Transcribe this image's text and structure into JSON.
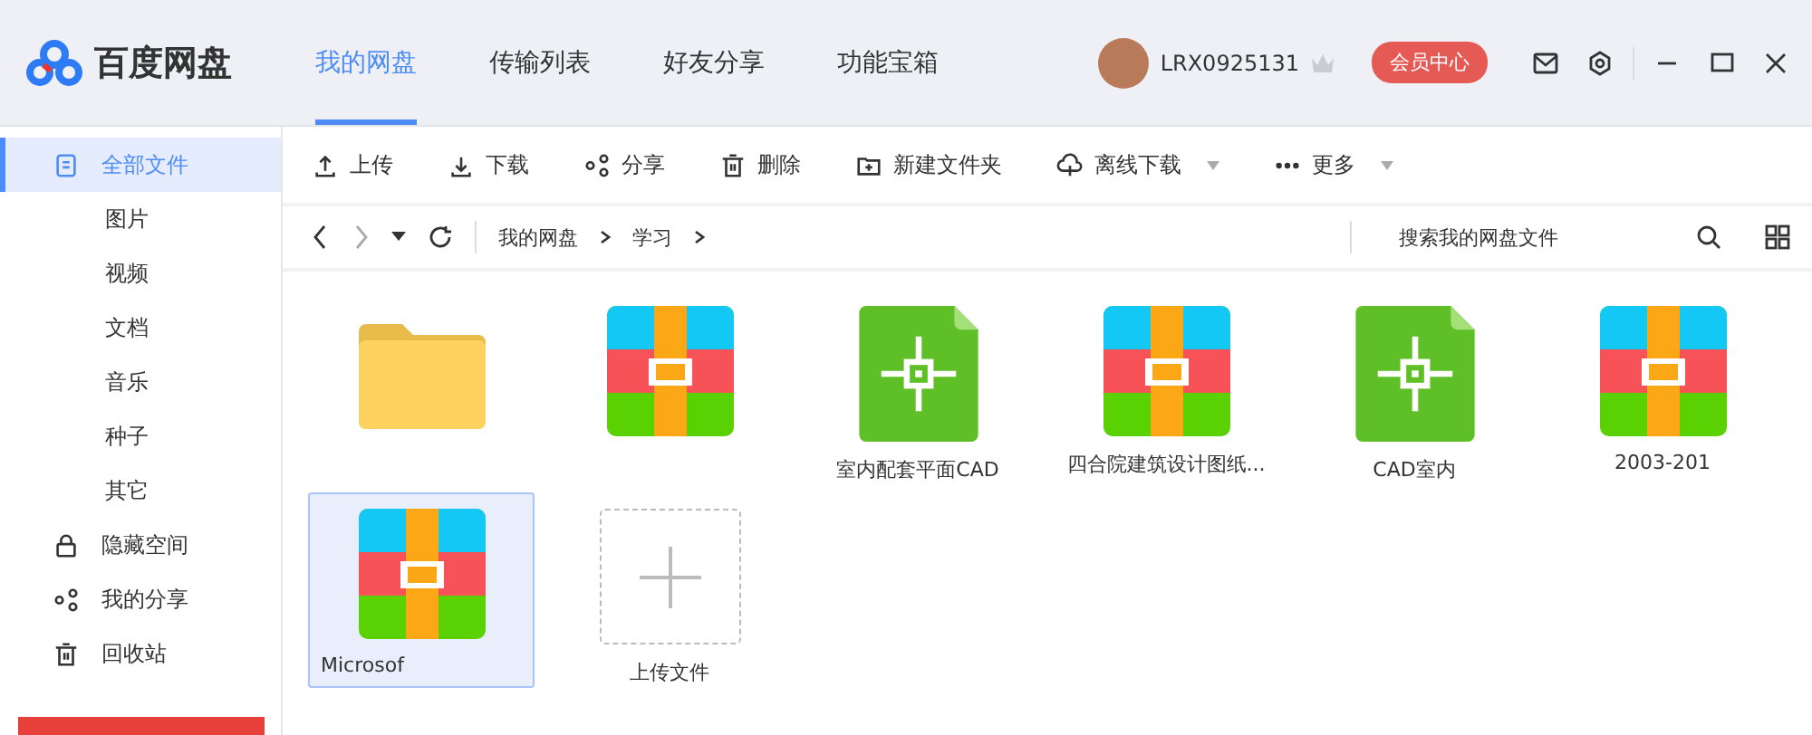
{
  "app": {
    "name": "百度网盘"
  },
  "nav_tabs": [
    {
      "label": "我的网盘",
      "selected": true
    },
    {
      "label": "传输列表",
      "selected": false
    },
    {
      "label": "好友分享",
      "selected": false
    },
    {
      "label": "功能宝箱",
      "selected": false
    }
  ],
  "user": {
    "name": "LRX0925131",
    "vip_button": "会员中心"
  },
  "sidebar": {
    "items": [
      {
        "label": "全部文件",
        "selected": true
      },
      {
        "label": "图片",
        "selected": false
      },
      {
        "label": "视频",
        "selected": false
      },
      {
        "label": "文档",
        "selected": false
      },
      {
        "label": "音乐",
        "selected": false
      },
      {
        "label": "种子",
        "selected": false
      },
      {
        "label": "其它",
        "selected": false
      },
      {
        "label": "隐藏空间",
        "selected": false
      },
      {
        "label": "我的分享",
        "selected": false
      },
      {
        "label": "回收站",
        "selected": false
      }
    ]
  },
  "toolbar": [
    {
      "label": "上传",
      "dropdown": false
    },
    {
      "label": "下载",
      "dropdown": false
    },
    {
      "label": "分享",
      "dropdown": false
    },
    {
      "label": "删除",
      "dropdown": false
    },
    {
      "label": "新建文件夹",
      "dropdown": false
    },
    {
      "label": "离线下载",
      "dropdown": true
    },
    {
      "label": "更多",
      "dropdown": true
    }
  ],
  "breadcrumb": [
    "我的网盘",
    "学习"
  ],
  "search": {
    "placeholder": "搜索我的网盘文件"
  },
  "files": [
    {
      "kind": "folder",
      "selected": false
    },
    {
      "kind": "archive",
      "selected": false
    },
    {
      "kind": "cad",
      "name": "室内配套平面CAD",
      "selected": false
    },
    {
      "kind": "archive",
      "name": "四合院建筑设计图纸...",
      "selected": false
    },
    {
      "kind": "cad",
      "name": "CAD室内",
      "selected": false
    },
    {
      "kind": "archive",
      "name": "2003-201",
      "selected": false
    },
    {
      "kind": "archive",
      "name": "Microsof",
      "selected": true
    },
    {
      "kind": "upload",
      "name": "上传文件",
      "selected": false
    }
  ]
}
